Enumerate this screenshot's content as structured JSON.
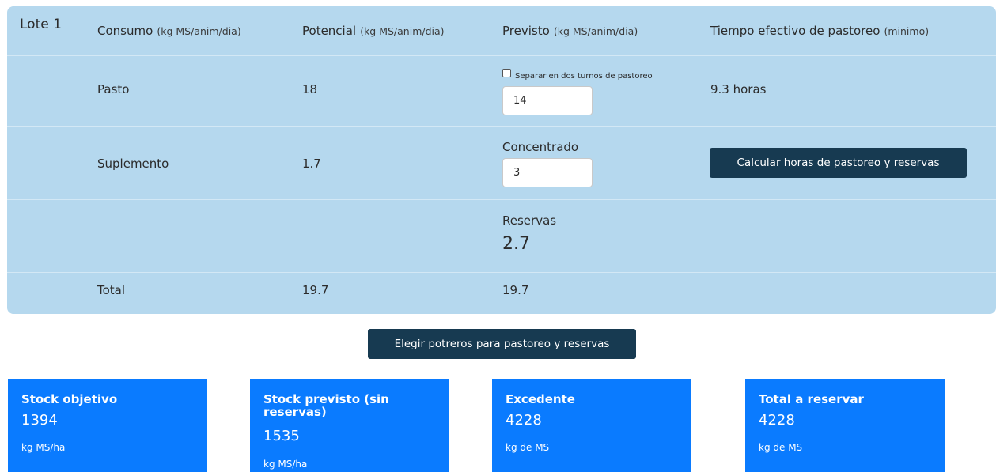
{
  "table": {
    "lote": "Lote 1",
    "headers": {
      "consumo": {
        "label": "Consumo",
        "unit": "(kg MS/anim/dia)"
      },
      "potencial": {
        "label": "Potencial",
        "unit": "(kg MS/anim/dia)"
      },
      "previsto": {
        "label": "Previsto",
        "unit": "(kg MS/anim/dia)"
      },
      "tiempo": {
        "label": "Tiempo efectivo de pastoreo",
        "unit": "(minimo)"
      }
    },
    "pasto": {
      "label": "Pasto",
      "potencial": "18",
      "checkbox_label": "Separar en dos turnos de pastoreo",
      "checkbox_checked": false,
      "previsto_value": "14",
      "tiempo": "9.3 horas"
    },
    "suplemento": {
      "label": "Suplemento",
      "potencial": "1.7",
      "concentrado_label": "Concentrado",
      "concentrado_value": "3",
      "calc_button": "Calcular horas de pastoreo y reservas"
    },
    "reservas": {
      "label": "Reservas",
      "value": "2.7"
    },
    "total": {
      "label": "Total",
      "potencial": "19.7",
      "previsto": "19.7"
    }
  },
  "elegir_button": "Elegir potreros para pastoreo y reservas",
  "cards": [
    {
      "title": "Stock objetivo",
      "value": "1394",
      "unit": "kg MS/ha"
    },
    {
      "title": "Stock previsto (sin reservas)",
      "value": "1535",
      "unit": "kg MS/ha"
    },
    {
      "title": "Excedente",
      "value": "4228",
      "unit": "kg de MS"
    },
    {
      "title": "Total a reservar",
      "value": "4228",
      "unit": "kg de MS"
    }
  ],
  "colors": {
    "panel": "#b5d8ee",
    "button": "#173a51",
    "card": "#0a7bff"
  }
}
